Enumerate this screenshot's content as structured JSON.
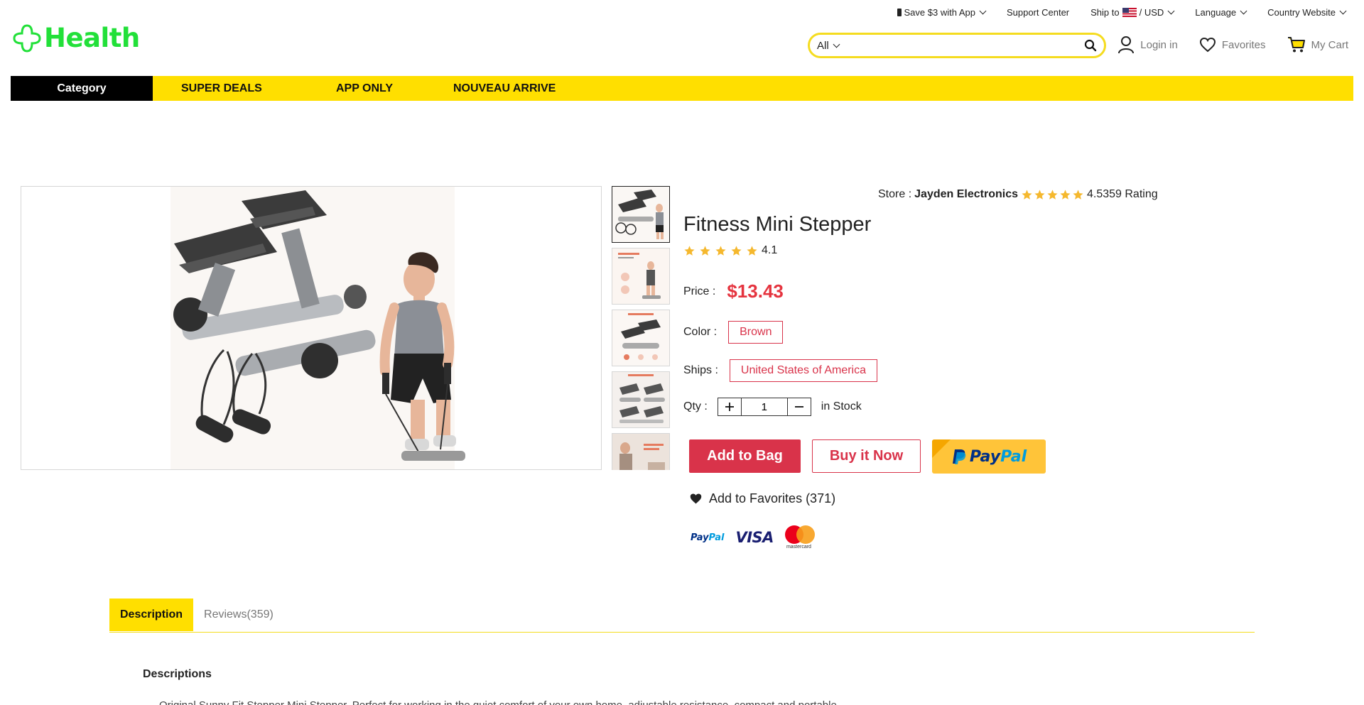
{
  "topbar": {
    "app_promo": "Save $3 with App",
    "support": "Support Center",
    "ship_to": "Ship to",
    "currency": "/ USD",
    "language": "Language",
    "country_website": "Country Website"
  },
  "logo": {
    "text": "Health",
    "color": "#22e039"
  },
  "search": {
    "category": "All",
    "placeholder": ""
  },
  "header_actions": {
    "login": "Login in",
    "favorites": "Favorites",
    "cart": "My Cart"
  },
  "nav": {
    "category": "Category",
    "items": [
      "SUPER DEALS",
      "APP ONLY",
      "NOUVEAU ARRIVE"
    ],
    "bar_color": "#ffdf00"
  },
  "store": {
    "label": "Store :",
    "name": "Jayden Electronics",
    "rating_text": "4.5359 Rating",
    "stars": 5
  },
  "product": {
    "title": "Fitness Mini Stepper",
    "rating": "4.1",
    "stars": 5,
    "price_label": "Price :",
    "price": "$13.43",
    "color_label": "Color :",
    "color_value": "Brown",
    "ships_label": "Ships :",
    "ships_value": "United States of America",
    "qty_label": "Qty :",
    "qty_value": "1",
    "stock": "in Stock",
    "add_to_bag": "Add to Bag",
    "buy_now": "Buy it Now",
    "paypal_a": "Pay",
    "paypal_b": "Pal",
    "favorites": "Add to Favorites (371)",
    "accent_color": "#d9334a"
  },
  "payment_logos": {
    "paypal_a": "Pay",
    "paypal_b": "Pal",
    "visa": "VISA",
    "mastercard": "mastercard"
  },
  "tabs": {
    "description": "Description",
    "reviews": "Reviews(359)"
  },
  "description": {
    "heading": "Descriptions",
    "text": "Original Sunny Fit Stepper Mini Stepper. Perfect for working in the quiet comfort of your own home, adjustable resistance, compact and portable."
  }
}
